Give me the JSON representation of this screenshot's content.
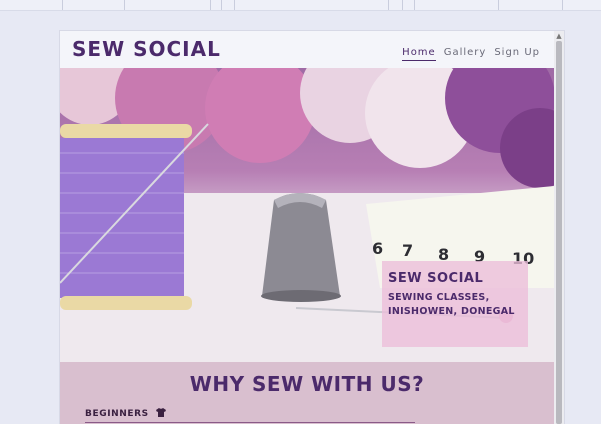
{
  "site": {
    "logo": "SEW SOCIAL",
    "nav": [
      {
        "label": "Home",
        "active": true
      },
      {
        "label": "Gallery",
        "active": false
      },
      {
        "label": "Sign Up",
        "active": false
      }
    ]
  },
  "hero": {
    "title": "SEW SOCIAL",
    "subtitle": "SEWING CLASSES, INISHOWEN, DONEGAL",
    "tape_numbers": [
      "6",
      "7",
      "8",
      "9",
      "10"
    ]
  },
  "why": {
    "title": "WHY SEW WITH US?",
    "level": "BEGINNERS",
    "level_icon": "tshirt-icon"
  },
  "colors": {
    "brand": "#4b2a6b",
    "hero_box": "#ecbeda",
    "section_bg": "#d9bfcf",
    "page_bg": "#e7e9f4"
  }
}
